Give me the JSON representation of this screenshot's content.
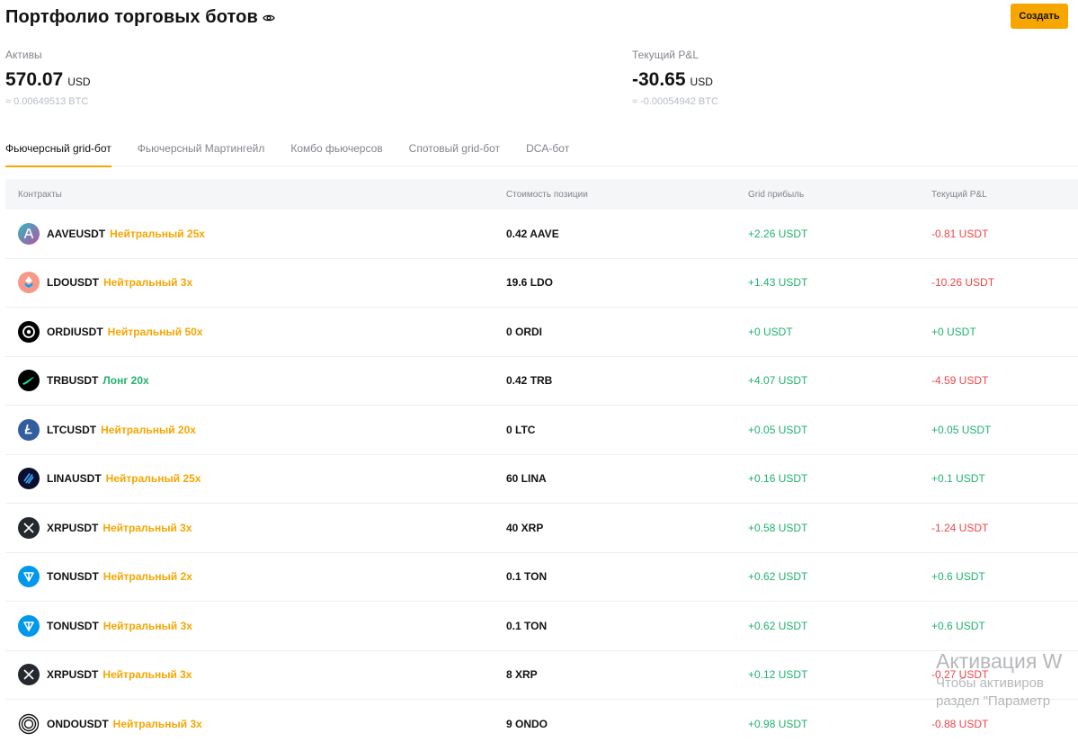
{
  "header": {
    "title": "Портфолио торговых ботов",
    "create_label": "Создать"
  },
  "summary": {
    "assets": {
      "label": "Активы",
      "value": "570.07",
      "unit": "USD",
      "btc": "≈ 0.00649513 BTC"
    },
    "pnl": {
      "label": "Текущий P&L",
      "value": "-30.65",
      "unit": "USD",
      "btc": "≈ -0.00054942 BTC"
    }
  },
  "tabs": [
    {
      "label": "Фьючерсный grid-бот",
      "active": true
    },
    {
      "label": "Фьючерсный Мартингейл"
    },
    {
      "label": "Комбо фьючерсов"
    },
    {
      "label": "Спотовый grid-бот"
    },
    {
      "label": "DCA-бот"
    }
  ],
  "table": {
    "headers": [
      "Контракты",
      "Стоимость позиции",
      "Grid прибыль",
      "Текущий P&L"
    ],
    "rows": [
      {
        "pair": "AAVEUSDT",
        "mode": "Нейтральный 25x",
        "mode_type": "neutral",
        "icon": "aave-icon",
        "position": "0.42 AAVE",
        "grid": "+2.26 USDT",
        "pnl": "-0.81 USDT",
        "pnl_sign": "red"
      },
      {
        "pair": "LDOUSDT",
        "mode": "Нейтральный 3x",
        "mode_type": "neutral",
        "icon": "ldo-icon",
        "position": "19.6 LDO",
        "grid": "+1.43 USDT",
        "pnl": "-10.26 USDT",
        "pnl_sign": "red"
      },
      {
        "pair": "ORDIUSDT",
        "mode": "Нейтральный 50x",
        "mode_type": "neutral",
        "icon": "ordi-icon",
        "position": "0 ORDI",
        "grid": "+0 USDT",
        "pnl": "+0 USDT",
        "pnl_sign": "green"
      },
      {
        "pair": "TRBUSDT",
        "mode": "Лонг 20x",
        "mode_type": "long",
        "icon": "trb-icon",
        "position": "0.42 TRB",
        "grid": "+4.07 USDT",
        "pnl": "-4.59 USDT",
        "pnl_sign": "red"
      },
      {
        "pair": "LTCUSDT",
        "mode": "Нейтральный 20x",
        "mode_type": "neutral",
        "icon": "ltc-icon",
        "position": "0 LTC",
        "grid": "+0.05 USDT",
        "pnl": "+0.05 USDT",
        "pnl_sign": "green"
      },
      {
        "pair": "LINAUSDT",
        "mode": "Нейтральный 25x",
        "mode_type": "neutral",
        "icon": "lina-icon",
        "position": "60 LINA",
        "grid": "+0.16 USDT",
        "pnl": "+0.1 USDT",
        "pnl_sign": "green"
      },
      {
        "pair": "XRPUSDT",
        "mode": "Нейтральный 3x",
        "mode_type": "neutral",
        "icon": "xrp-icon",
        "position": "40 XRP",
        "grid": "+0.58 USDT",
        "pnl": "-1.24 USDT",
        "pnl_sign": "red"
      },
      {
        "pair": "TONUSDT",
        "mode": "Нейтральный 2x",
        "mode_type": "neutral",
        "icon": "ton-icon",
        "position": "0.1 TON",
        "grid": "+0.62 USDT",
        "pnl": "+0.6 USDT",
        "pnl_sign": "green"
      },
      {
        "pair": "TONUSDT",
        "mode": "Нейтральный 3x",
        "mode_type": "neutral",
        "icon": "ton-icon",
        "position": "0.1 TON",
        "grid": "+0.62 USDT",
        "pnl": "+0.6 USDT",
        "pnl_sign": "green"
      },
      {
        "pair": "XRPUSDT",
        "mode": "Нейтральный 3x",
        "mode_type": "neutral",
        "icon": "xrp-icon",
        "position": "8 XRP",
        "grid": "+0.12 USDT",
        "pnl": "-0.27 USDT",
        "pnl_sign": "red"
      },
      {
        "pair": "ONDOUSDT",
        "mode": "Нейтральный 3x",
        "mode_type": "neutral",
        "icon": "ondo-icon",
        "position": "9 ONDO",
        "grid": "+0.98 USDT",
        "pnl": "-0.88 USDT",
        "pnl_sign": "red"
      }
    ]
  },
  "colors": {
    "accent": "#f7a600",
    "green": "#20b26c",
    "red": "#ef454a",
    "muted": "#81858c"
  },
  "watermark": {
    "line1": "Активация W",
    "line2": "Чтобы активиров",
    "line3": "раздел \"Параметр"
  }
}
